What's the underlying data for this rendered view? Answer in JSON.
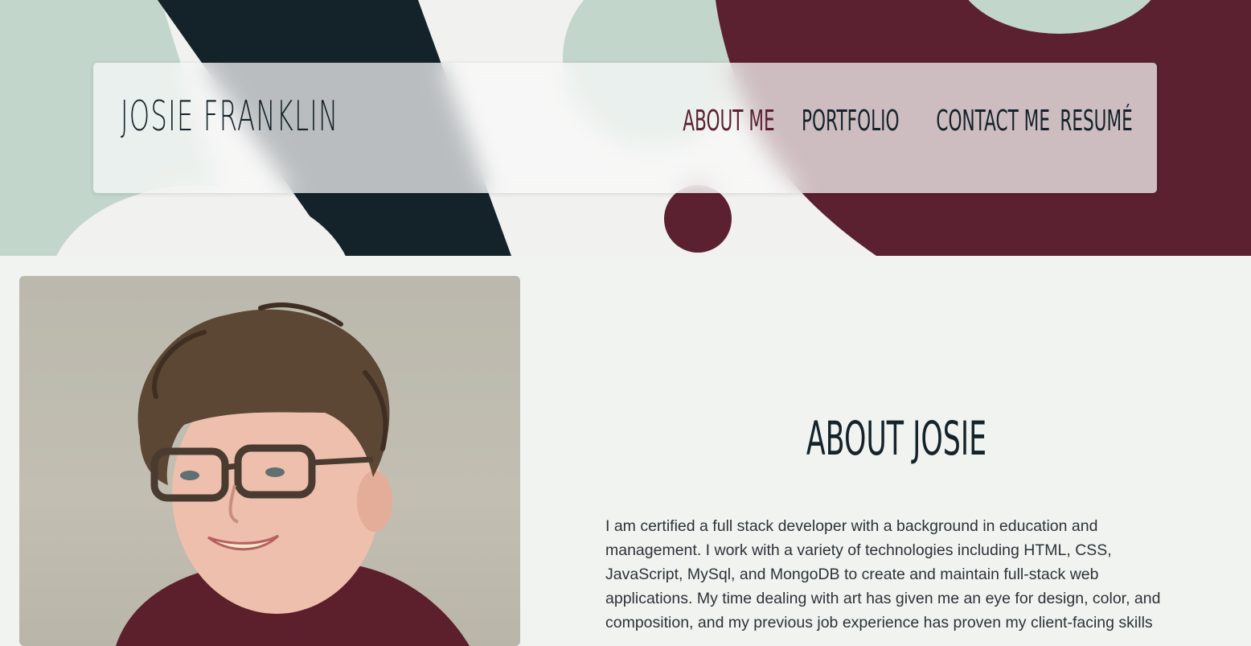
{
  "site": {
    "brand": "Josie Franklin"
  },
  "nav": {
    "items": [
      {
        "label": "About Me",
        "active": true
      },
      {
        "label": "Portfolio",
        "active": false
      },
      {
        "label": "Contact Me",
        "active": false
      },
      {
        "label": "Resumé",
        "active": false
      }
    ]
  },
  "about": {
    "title": "About Josie",
    "body": "I am certified a full stack developer with a background in education and management. I work with a variety of technologies including HTML, CSS, JavaScript, MySql, and MongoDB to create and maintain full-stack web applications. My time dealing with art has given me an eye for design, color, and composition, and my previous job experience has proven my client-facing skills"
  },
  "colors": {
    "dark": "#14232a",
    "maroon": "#5b2130",
    "sage": "#c2d6cb",
    "cream": "#f1f1ef",
    "page_bg": "#f1f3f0"
  },
  "photo": {
    "alt_icon": "portrait-photo"
  }
}
